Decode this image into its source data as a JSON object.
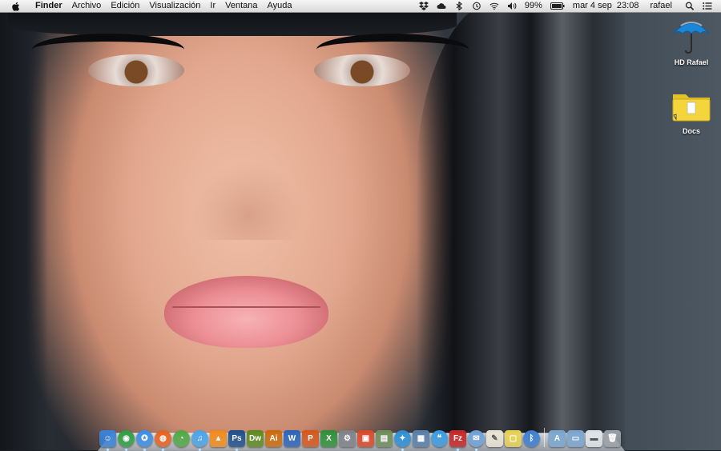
{
  "menubar": {
    "app_name": "Finder",
    "menus": [
      "Archivo",
      "Edición",
      "Visualización",
      "Ir",
      "Ventana",
      "Ayuda"
    ],
    "battery": "99%",
    "datetime": "mar 4 sep  23:08",
    "user": "rafael"
  },
  "desktop": {
    "icons": [
      {
        "label": "HD Rafael",
        "icon": "umbrella-drive-icon"
      },
      {
        "label": "Docs",
        "icon": "folder-icon"
      }
    ]
  },
  "dock": {
    "apps": [
      {
        "icon": "finder-icon",
        "color": "#3b82d6",
        "glyph": "☺"
      },
      {
        "icon": "chrome-icon",
        "color": "#2f9e44",
        "glyph": "◉"
      },
      {
        "icon": "safari-icon",
        "color": "#3a8ee6",
        "glyph": "✪"
      },
      {
        "icon": "firefox-icon",
        "color": "#e8621f",
        "glyph": "◍"
      },
      {
        "icon": "adium-icon",
        "color": "#4fa845",
        "glyph": "◔"
      },
      {
        "icon": "itunes-icon",
        "color": "#4aa3e8",
        "glyph": "♫"
      },
      {
        "icon": "vlc-icon",
        "color": "#f08a1c",
        "glyph": "▲"
      },
      {
        "icon": "photoshop-icon",
        "color": "#1f4f8c",
        "glyph": "Ps"
      },
      {
        "icon": "dreamweaver-icon",
        "color": "#5d8a1f",
        "glyph": "Dw"
      },
      {
        "icon": "illustrator-icon",
        "color": "#c96a0c",
        "glyph": "Ai"
      },
      {
        "icon": "word-icon",
        "color": "#2c64b8",
        "glyph": "W"
      },
      {
        "icon": "powerpoint-icon",
        "color": "#d2571d",
        "glyph": "P"
      },
      {
        "icon": "excel-icon",
        "color": "#2f8f3a",
        "glyph": "X"
      },
      {
        "icon": "system-preferences-icon",
        "color": "#7d8288",
        "glyph": "⚙"
      },
      {
        "icon": "transmission-icon",
        "color": "#d84a2a",
        "glyph": "▣"
      },
      {
        "icon": "preview-icon",
        "color": "#6f8e5a",
        "glyph": "▤"
      },
      {
        "icon": "twitter-icon",
        "color": "#2c8fd6",
        "glyph": "✦"
      },
      {
        "icon": "iphoto-icon",
        "color": "#5b7fa8",
        "glyph": "▦"
      },
      {
        "icon": "messages-icon",
        "color": "#3c9be0",
        "glyph": "❝"
      },
      {
        "icon": "filezilla-icon",
        "color": "#c62828",
        "glyph": "Fz"
      },
      {
        "icon": "mail-icon",
        "color": "#6fa2d8",
        "glyph": "✉"
      },
      {
        "icon": "textedit-icon",
        "color": "#e9e4d2",
        "glyph": "✎"
      },
      {
        "icon": "stickies-icon",
        "color": "#e8d255",
        "glyph": "▢"
      },
      {
        "icon": "bluetooth-icon",
        "color": "#3d7fd1",
        "glyph": "ᛒ"
      }
    ],
    "stacks": [
      {
        "icon": "applications-folder-icon",
        "color": "#7aa6cf",
        "glyph": "A"
      },
      {
        "icon": "documents-folder-icon",
        "color": "#7aa6cf",
        "glyph": "▭"
      },
      {
        "icon": "downloads-stack-icon",
        "color": "#dfe3e8",
        "glyph": "▬"
      },
      {
        "icon": "trash-icon",
        "color": "#9aa0a6",
        "glyph": "🗑"
      }
    ]
  }
}
